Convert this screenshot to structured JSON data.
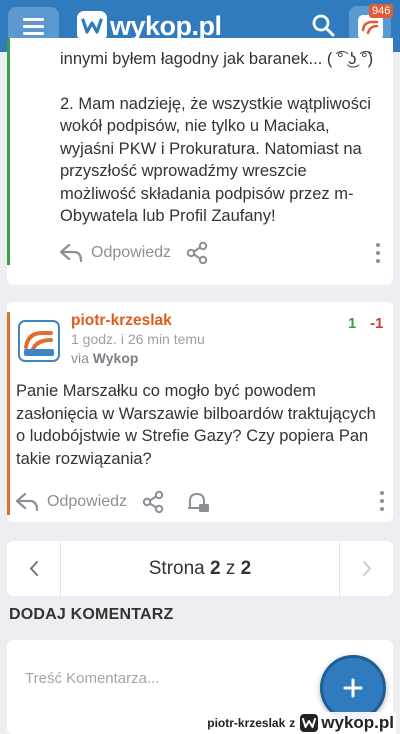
{
  "header": {
    "logo_text": "wykop.pl",
    "notification_count": "946",
    "brand_color": "#2f7bbd"
  },
  "comment_top": {
    "paragraphs": [
      "innymi byłem łagodny jak baranek... ( ͡° ͜ʖ ͡°)",
      "2. Mam nadzieję, że wszystkie wątpliwości wokół podpisów, nie tylko u Maciaka, wyjaśni PKW i Prokuratura. Natomiast na przyszłość wprowadźmy wreszcie możliwość składania podpisów przez m-Obywatela lub Profil Zaufany!"
    ],
    "reply_label": "Odpowiedz"
  },
  "comment_2": {
    "author": "piotr-krzeslak",
    "time": "1 godz. i 26 min temu",
    "via_prefix": "via",
    "via_source": "Wykop",
    "votes_up": "1",
    "votes_down": "-1",
    "text": "Panie Marszałku co mogło być powodem zasłonięcia w Warszawie bilboardów traktujących o ludobójstwie w Strefie Gazy? Czy popiera Pan takie rozwiązania?",
    "reply_label": "Odpowiedz"
  },
  "pagination": {
    "prefix": "Strona ",
    "current": "2",
    "separator": " z ",
    "total": "2"
  },
  "add_comment": {
    "title": "DODAJ KOMENTARZ",
    "placeholder": "Treść Komentarza..."
  },
  "watermark": {
    "user": "piotr-krzeslak",
    "separator": "z",
    "logo_text": "wykop.pl"
  }
}
